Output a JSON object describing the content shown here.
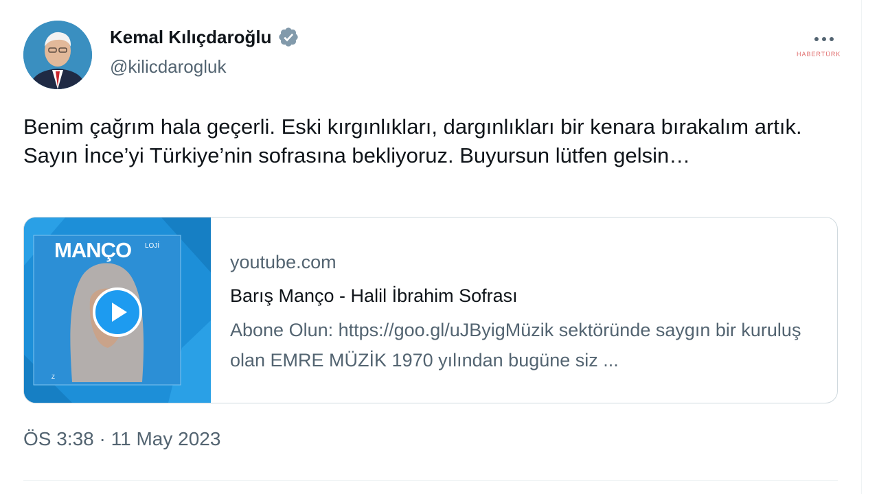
{
  "tweet": {
    "author": {
      "name": "Kemal Kılıçdaroğlu",
      "handle": "@kilicdarogluk",
      "verified": true,
      "avatar_icon": "profile-photo"
    },
    "text": "Benim çağrım hala geçerli. Eski kırgınlıkları, dargınlıkları bir kenara bırakalım artık. Sayın İnce’yi Türkiye’nin sofrasına bekliyoruz. Buyursun lütfen gelsin…",
    "timestamp": "ÖS 3:38 · 11 May 2023"
  },
  "link_card": {
    "thumbnail": {
      "title": "MANÇO",
      "title_suffix": "LOJİ",
      "caption": "Z"
    },
    "domain": "youtube.com",
    "title": "Barış Manço - Halil İbrahim Sofrası",
    "description": "Abone Olun: https://goo.gl/uJByigMüzik sektöründe saygın bir kuruluş olan EMRE MÜZİK 1970 yılından bugüne siz ..."
  },
  "watermark": "HABERTÜRK",
  "colors": {
    "accent": "#1d9bf0",
    "secondary_text": "#536471",
    "border": "#cfd9de",
    "thumbnail_blue": "#1d8fd8"
  }
}
